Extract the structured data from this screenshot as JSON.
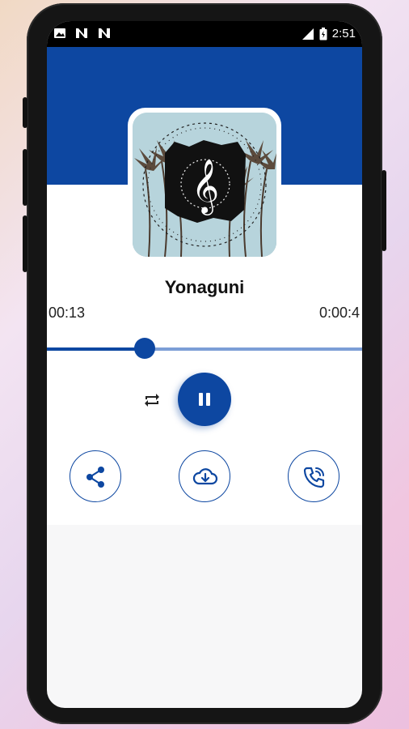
{
  "statusbar": {
    "time": "2:51",
    "notifications": [
      "image-icon",
      "n-icon",
      "n-icon"
    ]
  },
  "player": {
    "song_title": "Yonaguni",
    "elapsed": "00:13",
    "duration": "0:00:4",
    "progress_fraction": 0.31
  },
  "actions": {
    "repeat_icon": "repeat-icon",
    "pause_icon": "pause-icon",
    "share_icon": "share-icon",
    "download_icon": "cloud-download-icon",
    "ringtone_icon": "phone-call-icon"
  },
  "colors": {
    "accent": "#0d47a1",
    "track": "#7c9ed6"
  }
}
